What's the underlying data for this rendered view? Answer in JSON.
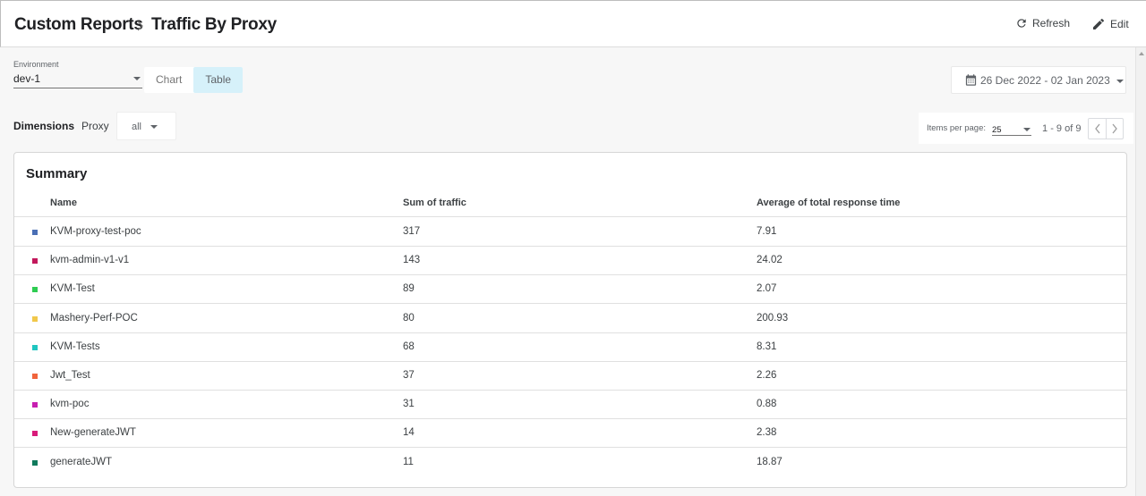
{
  "header": {
    "breadcrumb": [
      "Custom Reports",
      "Traffic By Proxy"
    ],
    "refresh_label": "Refresh",
    "edit_label": "Edit"
  },
  "filters": {
    "environment_label": "Environment",
    "environment_value": "dev-1",
    "view_toggle": [
      {
        "label": "Chart",
        "active": false
      },
      {
        "label": "Table",
        "active": true
      }
    ],
    "date_range": "26 Dec 2022 - 02 Jan 2023",
    "dimensions_label": "Dimensions",
    "proxy_label": "Proxy",
    "proxy_value": "all"
  },
  "pagination": {
    "items_per_page_label": "Items per page:",
    "items_per_page": "25",
    "range_label": "1 - 9 of 9"
  },
  "summary": {
    "title": "Summary",
    "columns": [
      "Name",
      "Sum of traffic",
      "Average of total response time"
    ],
    "rows": [
      {
        "name": "KVM-proxy-test-poc",
        "traffic": "317",
        "response": "7.91",
        "color": "#4a6fb5"
      },
      {
        "name": "kvm-admin-v1-v1",
        "traffic": "143",
        "response": "24.02",
        "color": "#c2185b"
      },
      {
        "name": "KVM-Test",
        "traffic": "89",
        "response": "2.07",
        "color": "#2ecc52"
      },
      {
        "name": "Mashery-Perf-POC",
        "traffic": "80",
        "response": "200.93",
        "color": "#f1c84b"
      },
      {
        "name": "KVM-Tests",
        "traffic": "68",
        "response": "8.31",
        "color": "#1fc6c0"
      },
      {
        "name": "Jwt_Test",
        "traffic": "37",
        "response": "2.26",
        "color": "#f0643c"
      },
      {
        "name": "kvm-poc",
        "traffic": "31",
        "response": "0.88",
        "color": "#c71fb0"
      },
      {
        "name": "New-generateJWT",
        "traffic": "14",
        "response": "2.38",
        "color": "#d81b7a"
      },
      {
        "name": "generateJWT",
        "traffic": "11",
        "response": "18.87",
        "color": "#0f7a5c"
      }
    ]
  }
}
